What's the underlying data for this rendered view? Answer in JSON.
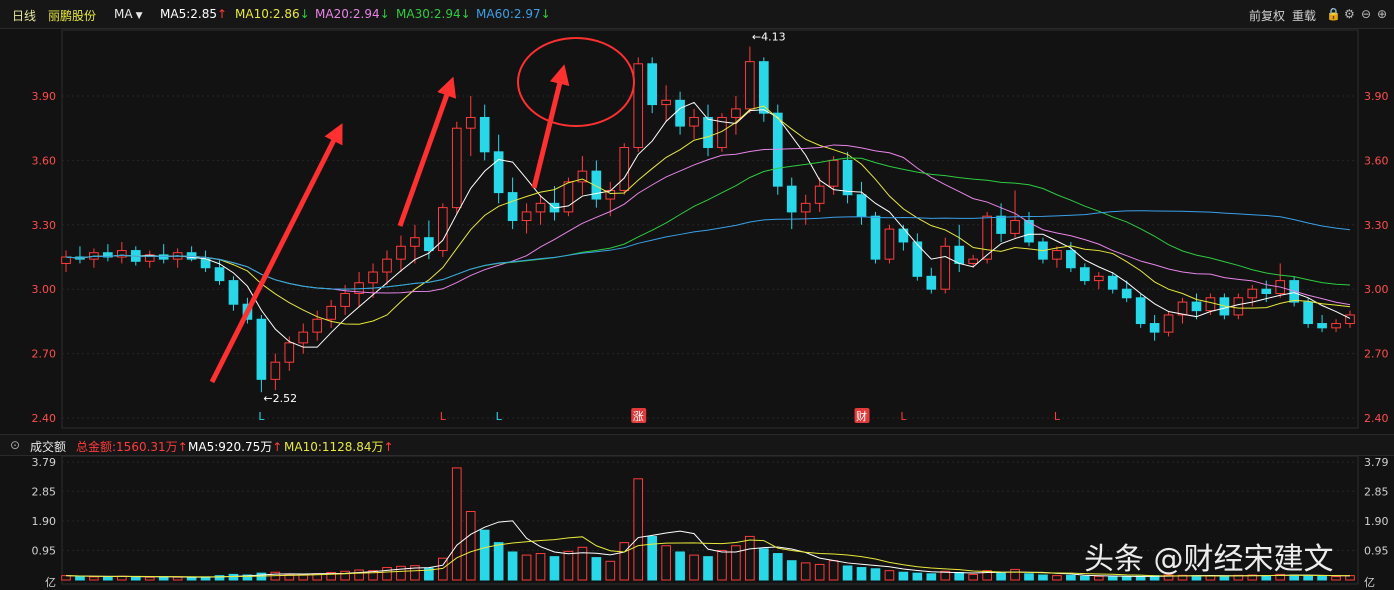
{
  "header": {
    "period": "日线",
    "stock_name": "丽鹏股份",
    "indicator": "MA",
    "ma5": "MA5:2.85",
    "ma10": "MA10:2.86",
    "ma20": "MA20:2.94",
    "ma30": "MA30:2.94",
    "ma60": "MA60:2.97",
    "right_buttons": [
      "前复权",
      "重载"
    ]
  },
  "volume_header": {
    "title": "成交额",
    "total": "总金额:1560.31万",
    "ma5": "MA5:920.75万",
    "ma10": "MA10:1128.84万"
  },
  "price_axis": [
    "3.90",
    "3.60",
    "3.30",
    "3.00",
    "2.70",
    "2.40"
  ],
  "volume_axis": [
    "3.79",
    "2.85",
    "1.90",
    "0.95",
    "亿"
  ],
  "annotations": {
    "low_label": "←2.52",
    "high_label": "←4.13",
    "markers": [
      {
        "text": "L",
        "kind": "up"
      },
      {
        "text": "L",
        "kind": "down"
      },
      {
        "text": "L",
        "kind": "up"
      },
      {
        "text": "涨",
        "kind": "badge"
      },
      {
        "text": "财",
        "kind": "badge"
      },
      {
        "text": "L",
        "kind": "down"
      },
      {
        "text": "L",
        "kind": "down"
      }
    ]
  },
  "watermark": "头条 @财经宋建文",
  "colors": {
    "up": "#ff3b3b",
    "down": "#28d7e8",
    "ma5": "#ffffff",
    "ma10": "#e8e83a",
    "ma20": "#e884e8",
    "ma30": "#2ecc40",
    "ma60": "#3aa0e8",
    "arrow": "#ff3030"
  },
  "chart_data": {
    "type": "candlestick",
    "ylim": [
      2.4,
      4.2
    ],
    "volume_ylim": [
      0,
      3.79
    ],
    "volume_unit": "亿",
    "series": [
      {
        "name": "MA5",
        "value": 2.85
      },
      {
        "name": "MA10",
        "value": 2.86
      },
      {
        "name": "MA20",
        "value": 2.94
      },
      {
        "name": "MA30",
        "value": 2.94
      },
      {
        "name": "MA60",
        "value": 2.97
      }
    ],
    "candles": [
      [
        3.12,
        3.18,
        3.08,
        3.15
      ],
      [
        3.15,
        3.2,
        3.12,
        3.14
      ],
      [
        3.14,
        3.19,
        3.1,
        3.17
      ],
      [
        3.17,
        3.21,
        3.13,
        3.15
      ],
      [
        3.15,
        3.22,
        3.12,
        3.18
      ],
      [
        3.18,
        3.2,
        3.11,
        3.13
      ],
      [
        3.13,
        3.18,
        3.1,
        3.16
      ],
      [
        3.16,
        3.21,
        3.12,
        3.14
      ],
      [
        3.14,
        3.19,
        3.1,
        3.17
      ],
      [
        3.17,
        3.2,
        3.13,
        3.14
      ],
      [
        3.14,
        3.18,
        3.08,
        3.1
      ],
      [
        3.1,
        3.14,
        3.02,
        3.04
      ],
      [
        3.04,
        3.06,
        2.9,
        2.93
      ],
      [
        2.93,
        2.96,
        2.84,
        2.86
      ],
      [
        2.86,
        2.88,
        2.52,
        2.58
      ],
      [
        2.58,
        2.7,
        2.53,
        2.66
      ],
      [
        2.66,
        2.78,
        2.62,
        2.75
      ],
      [
        2.75,
        2.84,
        2.7,
        2.8
      ],
      [
        2.8,
        2.9,
        2.76,
        2.86
      ],
      [
        2.86,
        2.95,
        2.82,
        2.92
      ],
      [
        2.92,
        3.02,
        2.88,
        2.98
      ],
      [
        2.98,
        3.08,
        2.92,
        3.03
      ],
      [
        3.03,
        3.12,
        2.96,
        3.08
      ],
      [
        3.08,
        3.18,
        3.02,
        3.14
      ],
      [
        3.14,
        3.25,
        3.08,
        3.2
      ],
      [
        3.2,
        3.3,
        3.12,
        3.24
      ],
      [
        3.24,
        3.32,
        3.14,
        3.18
      ],
      [
        3.18,
        3.4,
        3.15,
        3.38
      ],
      [
        3.38,
        3.78,
        3.35,
        3.75
      ],
      [
        3.75,
        3.9,
        3.62,
        3.8
      ],
      [
        3.8,
        3.86,
        3.6,
        3.64
      ],
      [
        3.64,
        3.72,
        3.4,
        3.45
      ],
      [
        3.45,
        3.52,
        3.28,
        3.32
      ],
      [
        3.32,
        3.4,
        3.26,
        3.36
      ],
      [
        3.36,
        3.44,
        3.3,
        3.4
      ],
      [
        3.4,
        3.48,
        3.32,
        3.36
      ],
      [
        3.36,
        3.52,
        3.34,
        3.5
      ],
      [
        3.5,
        3.62,
        3.44,
        3.55
      ],
      [
        3.55,
        3.6,
        3.38,
        3.42
      ],
      [
        3.42,
        3.5,
        3.34,
        3.46
      ],
      [
        3.46,
        3.68,
        3.44,
        3.66
      ],
      [
        3.66,
        4.08,
        3.64,
        4.05
      ],
      [
        4.05,
        4.08,
        3.82,
        3.86
      ],
      [
        3.86,
        3.95,
        3.78,
        3.88
      ],
      [
        3.88,
        3.92,
        3.72,
        3.76
      ],
      [
        3.76,
        3.84,
        3.7,
        3.8
      ],
      [
        3.8,
        3.86,
        3.62,
        3.66
      ],
      [
        3.66,
        3.82,
        3.64,
        3.8
      ],
      [
        3.8,
        3.9,
        3.72,
        3.84
      ],
      [
        3.84,
        4.13,
        3.82,
        4.06
      ],
      [
        4.06,
        4.08,
        3.78,
        3.82
      ],
      [
        3.82,
        3.86,
        3.44,
        3.48
      ],
      [
        3.48,
        3.52,
        3.28,
        3.36
      ],
      [
        3.36,
        3.44,
        3.3,
        3.4
      ],
      [
        3.4,
        3.52,
        3.36,
        3.48
      ],
      [
        3.48,
        3.62,
        3.44,
        3.6
      ],
      [
        3.6,
        3.64,
        3.4,
        3.44
      ],
      [
        3.44,
        3.5,
        3.3,
        3.34
      ],
      [
        3.34,
        3.36,
        3.12,
        3.14
      ],
      [
        3.14,
        3.3,
        3.12,
        3.28
      ],
      [
        3.28,
        3.3,
        3.18,
        3.22
      ],
      [
        3.22,
        3.26,
        3.04,
        3.06
      ],
      [
        3.06,
        3.1,
        2.98,
        3.0
      ],
      [
        3.0,
        3.24,
        2.98,
        3.2
      ],
      [
        3.2,
        3.3,
        3.08,
        3.12
      ],
      [
        3.12,
        3.16,
        3.1,
        3.14
      ],
      [
        3.14,
        3.36,
        3.12,
        3.34
      ],
      [
        3.34,
        3.4,
        3.22,
        3.26
      ],
      [
        3.26,
        3.46,
        3.24,
        3.32
      ],
      [
        3.32,
        3.36,
        3.2,
        3.22
      ],
      [
        3.22,
        3.24,
        3.12,
        3.14
      ],
      [
        3.14,
        3.2,
        3.1,
        3.18
      ],
      [
        3.18,
        3.22,
        3.08,
        3.1
      ],
      [
        3.1,
        3.12,
        3.02,
        3.04
      ],
      [
        3.04,
        3.08,
        3.0,
        3.06
      ],
      [
        3.06,
        3.08,
        2.98,
        3.0
      ],
      [
        3.0,
        3.04,
        2.94,
        2.96
      ],
      [
        2.96,
        2.98,
        2.82,
        2.84
      ],
      [
        2.84,
        2.88,
        2.76,
        2.8
      ],
      [
        2.8,
        2.9,
        2.78,
        2.88
      ],
      [
        2.88,
        2.96,
        2.84,
        2.94
      ],
      [
        2.94,
        2.98,
        2.86,
        2.9
      ],
      [
        2.9,
        2.98,
        2.88,
        2.96
      ],
      [
        2.96,
        2.98,
        2.86,
        2.88
      ],
      [
        2.88,
        2.98,
        2.86,
        2.96
      ],
      [
        2.96,
        3.02,
        2.92,
        3.0
      ],
      [
        3.0,
        3.04,
        2.94,
        2.98
      ],
      [
        2.98,
        3.12,
        2.96,
        3.04
      ],
      [
        3.04,
        3.06,
        2.92,
        2.94
      ],
      [
        2.94,
        2.96,
        2.82,
        2.84
      ],
      [
        2.84,
        2.88,
        2.8,
        2.82
      ],
      [
        2.82,
        2.86,
        2.8,
        2.84
      ],
      [
        2.84,
        2.9,
        2.82,
        2.88
      ]
    ],
    "volumes": [
      0.14,
      0.12,
      0.1,
      0.11,
      0.12,
      0.1,
      0.09,
      0.1,
      0.09,
      0.08,
      0.1,
      0.14,
      0.18,
      0.16,
      0.22,
      0.25,
      0.18,
      0.16,
      0.2,
      0.24,
      0.28,
      0.32,
      0.3,
      0.4,
      0.44,
      0.46,
      0.38,
      0.7,
      3.6,
      2.2,
      1.6,
      1.2,
      0.9,
      0.8,
      0.85,
      0.75,
      0.92,
      1.05,
      0.72,
      0.6,
      1.2,
      3.25,
      1.4,
      1.1,
      0.9,
      0.8,
      0.75,
      0.95,
      1.1,
      1.4,
      1.0,
      0.85,
      0.62,
      0.55,
      0.5,
      0.62,
      0.45,
      0.4,
      0.36,
      0.3,
      0.25,
      0.22,
      0.2,
      0.28,
      0.24,
      0.18,
      0.3,
      0.22,
      0.34,
      0.2,
      0.16,
      0.14,
      0.15,
      0.12,
      0.12,
      0.11,
      0.1,
      0.12,
      0.14,
      0.16,
      0.15,
      0.14,
      0.13,
      0.12,
      0.15,
      0.16,
      0.14,
      0.18,
      0.16,
      0.14,
      0.12,
      0.11,
      0.14
    ]
  }
}
